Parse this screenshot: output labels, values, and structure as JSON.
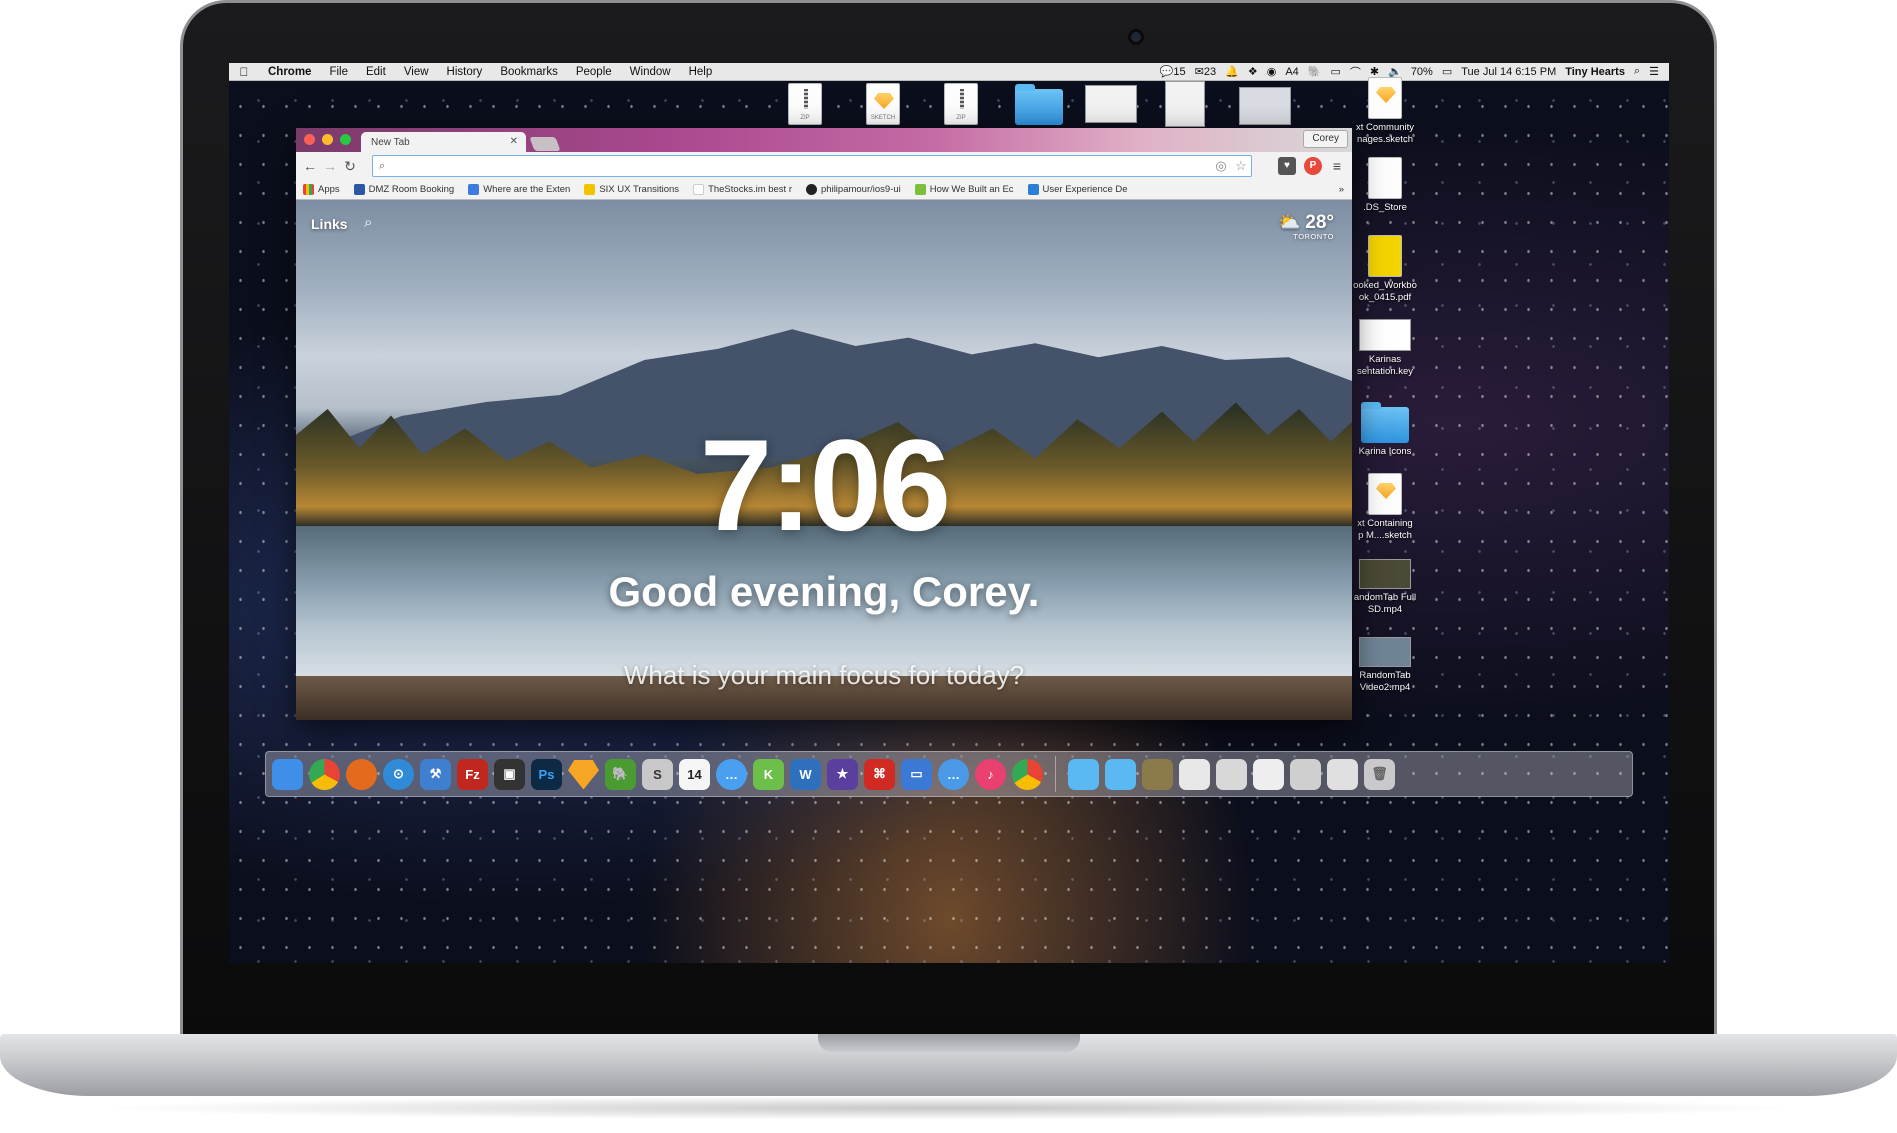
{
  "menubar": {
    "apple_icon": "apple-icon",
    "app_name": "Chrome",
    "menus": [
      "File",
      "Edit",
      "View",
      "History",
      "Bookmarks",
      "People",
      "Window",
      "Help"
    ],
    "status": {
      "messages_count": "15",
      "mail_count": "23",
      "battery": "70%",
      "datetime": "Tue Jul 14  6:15 PM",
      "user": "Tiny Hearts",
      "adobe_count": "4"
    }
  },
  "desktop": {
    "top_tags": [
      "ZIP",
      "SKETCH",
      "ZIP"
    ],
    "right_icons": [
      {
        "label": "xt Community\nnages.sketch",
        "icon": "sketch-file-icon"
      },
      {
        "label": ".DS_Store",
        "icon": "document-icon"
      },
      {
        "label": "ooked_Workbo\nok_0415.pdf",
        "icon": "pdf-file-icon"
      },
      {
        "label": "Karinas\nsentation.key",
        "icon": "keynote-file-icon"
      },
      {
        "label": "Karina Icons",
        "icon": "folder-icon"
      },
      {
        "label": "xt Containing\np M....sketch",
        "icon": "sketch-file-icon"
      },
      {
        "label": "andomTab Full\nSD.mp4",
        "icon": "video-file-icon"
      },
      {
        "label": "RandomTab\nVideo2.mp4",
        "icon": "video-file-icon"
      }
    ]
  },
  "chrome": {
    "tab_title": "New Tab",
    "profile_name": "Corey",
    "omnibox_value": "",
    "bookmarks": [
      {
        "label": "Apps",
        "color": "#e94335"
      },
      {
        "label": "DMZ Room Booking",
        "color": "#2b57a3"
      },
      {
        "label": "Where are the Exten",
        "color": "#3d7be0"
      },
      {
        "label": "SIX UX Transitions",
        "color": "#f2c300"
      },
      {
        "label": "TheStocks.im best r",
        "color": "#ffffff"
      },
      {
        "label": "philipamour/ios9-ui",
        "color": "#222222"
      },
      {
        "label": "How We Built an Ec",
        "color": "#7bbf3b"
      },
      {
        "label": "User Experience De",
        "color": "#2d7fd5"
      }
    ],
    "overflow_label": "»"
  },
  "momentum": {
    "links_label": "Links",
    "temperature": "28°",
    "city": "TORONTO",
    "time": "7:06",
    "greeting": "Good evening, Corey.",
    "focus_prompt": "What is your main focus for today?"
  },
  "dock": {
    "apps": [
      {
        "name": "finder-icon",
        "color": "#3f8ee8",
        "glyph": ""
      },
      {
        "name": "chrome-icon",
        "color": "#e7b43a",
        "glyph": ""
      },
      {
        "name": "firefox-icon",
        "color": "#e46a1e",
        "glyph": ""
      },
      {
        "name": "safari-icon",
        "color": "#2f8bd8",
        "glyph": ""
      },
      {
        "name": "xcode-icon",
        "color": "#3f7fd0",
        "glyph": ""
      },
      {
        "name": "filezilla-icon",
        "color": "#c0271f",
        "glyph": "Fz"
      },
      {
        "name": "app-icon",
        "color": "#333333",
        "glyph": ""
      },
      {
        "name": "photoshop-icon",
        "color": "#0d2a45",
        "glyph": "Ps"
      },
      {
        "name": "sketch-icon",
        "color": "#f6a623",
        "glyph": ""
      },
      {
        "name": "evernote-icon",
        "color": "#4b9b33",
        "glyph": ""
      },
      {
        "name": "s-app-icon",
        "color": "#c8c8c8",
        "glyph": "S"
      },
      {
        "name": "calendar-icon",
        "color": "#f5f5f5",
        "glyph": "14"
      },
      {
        "name": "messages-icon",
        "color": "#4aa0f0",
        "glyph": ""
      },
      {
        "name": "kik-icon",
        "color": "#6cc04a",
        "glyph": "K"
      },
      {
        "name": "word-icon",
        "color": "#2e6fbe",
        "glyph": "W"
      },
      {
        "name": "imovie-icon",
        "color": "#5b3f9e",
        "glyph": "★"
      },
      {
        "name": "acrobat-icon",
        "color": "#d02a22",
        "glyph": ""
      },
      {
        "name": "keynote-icon",
        "color": "#3a7ad6",
        "glyph": ""
      },
      {
        "name": "chat-icon",
        "color": "#4a9ae8",
        "glyph": ""
      },
      {
        "name": "itunes-icon",
        "color": "#e9406f",
        "glyph": "♪"
      },
      {
        "name": "chrome-canary-icon",
        "color": "#e7b43a",
        "glyph": ""
      }
    ],
    "stacks": [
      {
        "name": "applications-folder-icon",
        "color": "#5ab8f2"
      },
      {
        "name": "documents-folder-icon",
        "color": "#5ab8f2"
      },
      {
        "name": "stack-thumb-icon",
        "color": "#8b7b4a"
      },
      {
        "name": "stack-thumb-icon",
        "color": "#e8e8e8"
      },
      {
        "name": "stack-thumb-icon",
        "color": "#d8d8d8"
      },
      {
        "name": "stack-thumb-icon",
        "color": "#eeeeee"
      },
      {
        "name": "stack-thumb-icon",
        "color": "#cfcfcf"
      },
      {
        "name": "stack-thumb-icon",
        "color": "#e0e0e0"
      },
      {
        "name": "trash-icon",
        "color": "#c9c9cc"
      }
    ]
  }
}
